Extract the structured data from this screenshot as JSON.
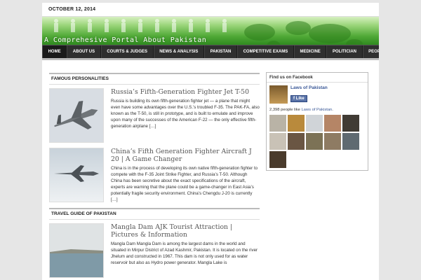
{
  "header": {
    "date": "OCTOBER 12, 2014",
    "slogan": "A Comprehesive Portal About Pakistan"
  },
  "nav": {
    "items": [
      "HOME",
      "ABOUT US",
      "COURTS & JUDGES",
      "NEWS & ANALYSIS",
      "PAKISTAN",
      "COMPETITIVE EXAMS",
      "MEDICINE",
      "POLITICIAN",
      "PEOPLE"
    ]
  },
  "sections": {
    "famous": "FAMOUS PERSONALITIES",
    "travel": "TRAVEL GUIDE OF PAKISTAN"
  },
  "posts": [
    {
      "title": "Russia’s Fifth-Generation Fighter Jet T-50",
      "excerpt": "Russia is building its own fifth-generation fighter jet — a plane that might even have some advantages over the U.S.’s troubled F-35. The PAK-FA, also known as the T-50, is still in prototype, and is built to emulate and improve upon many of the successes of the American F-22 — the only effective fifth-generation airplane […]"
    },
    {
      "title": "China’s Fifth Generation Fighter Aircraft J 20 | A Game Changer",
      "excerpt": "China is in the process of developing its own native fifth-generation fighter to compete with the F-35 Joint Strike Fighter, and Russia’s T-50. Although China has been secretive about the exact specifications of the aircraft, experts are warning that the plane could be a game-changer in East Asia’s potentially fragile security environment. China’s Chengdu J-20 is currently […]"
    },
    {
      "title": "Mangla Dam AJK Tourist Attraction | Pictures & Information",
      "excerpt": "Mangla Dam Mangla Dam is among the largest dams in the world and situated in Mirpur District of Azad Kashmir, Pakistan. It is located on the river Jhelum and constructed in 1967. This dam is not only used for as water reservoir but also as Hydro power generator. Mangla Lake is"
    }
  ],
  "facebook": {
    "heading": "Find us on Facebook",
    "page_name": "Laws of Pakistan",
    "like_label": "Like",
    "count_text": "2,398 people like ",
    "count_link": "Laws of Pakistan",
    "count_end": "."
  },
  "colors": {
    "banner_green": "#4fa836",
    "nav_bg": "#2f2f2f",
    "fb_blue": "#3b5998"
  }
}
